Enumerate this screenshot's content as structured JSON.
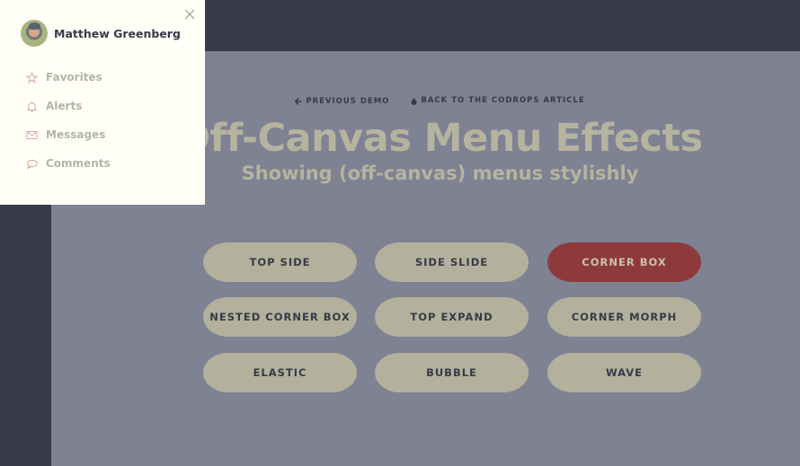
{
  "menu": {
    "user_name": "Matthew Greenberg",
    "close_icon": "close-icon",
    "items": [
      {
        "label": "Favorites",
        "icon": "star-icon"
      },
      {
        "label": "Alerts",
        "icon": "bell-icon"
      },
      {
        "label": "Messages",
        "icon": "envelope-icon"
      },
      {
        "label": "Comments",
        "icon": "speech-bubble-icon"
      }
    ]
  },
  "header": {
    "links": [
      {
        "label": "PREVIOUS DEMO",
        "icon": "arrow-left-icon",
        "glyph": "🡐"
      },
      {
        "label": "BACK TO THE CODROPS ARTICLE",
        "icon": "droplet-icon",
        "glyph": "💧"
      }
    ],
    "title": "Off-Canvas Menu Effects",
    "subtitle": "Showing (off-canvas) menus stylishly"
  },
  "demos": {
    "buttons": [
      {
        "label": "TOP SIDE",
        "active": false
      },
      {
        "label": "SIDE SLIDE",
        "active": false
      },
      {
        "label": "CORNER BOX",
        "active": true
      },
      {
        "label": "NESTED CORNER BOX",
        "active": false
      },
      {
        "label": "TOP EXPAND",
        "active": false
      },
      {
        "label": "CORNER MORPH",
        "active": false
      },
      {
        "label": "ELASTIC",
        "active": false
      },
      {
        "label": "BUBBLE",
        "active": false
      },
      {
        "label": "WAVE",
        "active": false
      }
    ]
  },
  "colors": {
    "frame": "#373a47",
    "content_bg": "#7e8293",
    "button": "#b3b19c",
    "button_active": "#8e3a3c",
    "menu_bg": "#fffff8",
    "menu_icon": "#e0a79a"
  }
}
